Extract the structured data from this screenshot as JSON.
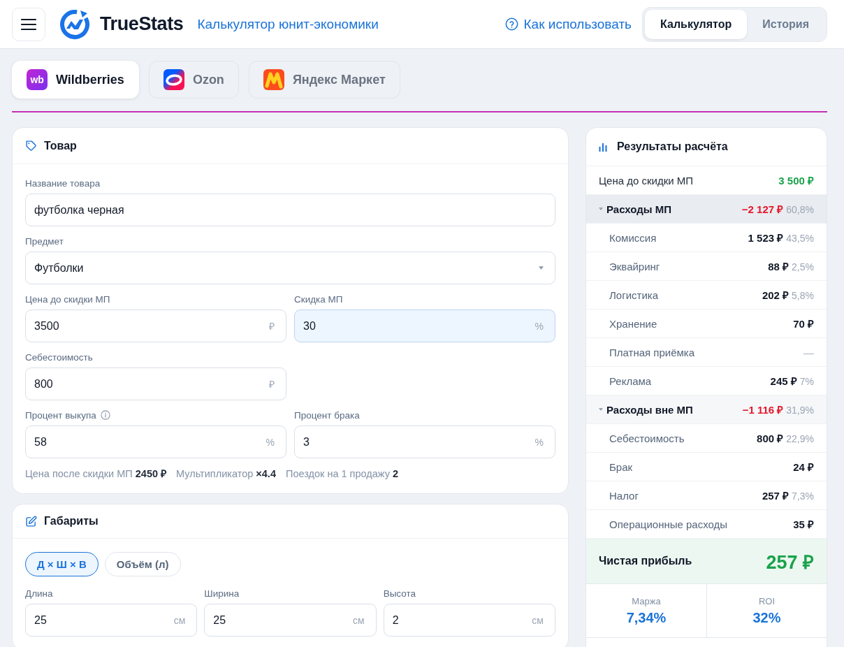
{
  "header": {
    "brand": "TrueStats",
    "subtitle": "Калькулятор юнит-экономики",
    "help_link": "Как использовать",
    "view_tabs": [
      {
        "label": "Калькулятор",
        "selected": true
      },
      {
        "label": "История",
        "selected": false
      }
    ]
  },
  "marketplace_tabs": [
    {
      "kind": "wildberries",
      "logo_text": "wb",
      "label": "Wildberries",
      "selected": true
    },
    {
      "kind": "ozon",
      "label": "Ozon",
      "selected": false
    },
    {
      "kind": "yandex",
      "label": "Яндекс Маркет",
      "selected": false
    }
  ],
  "product_card": {
    "title": "Товар",
    "rows": [
      [
        {
          "kind": "text",
          "label": "Название товара",
          "info": false,
          "value": "футболка черная",
          "focused": false
        }
      ],
      [
        {
          "kind": "select",
          "label": "Предмет",
          "info": false,
          "value": "Футболки",
          "focused": false
        }
      ],
      [
        {
          "kind": "number",
          "label": "Цена до скидки МП",
          "info": false,
          "value": "3500",
          "unit": "₽",
          "focused": false
        },
        {
          "kind": "number",
          "label": "Скидка МП",
          "info": false,
          "value": "30",
          "unit": "%",
          "focused": true
        }
      ],
      [
        {
          "kind": "number",
          "label": "Себестоимость",
          "info": false,
          "value": "800",
          "unit": "₽",
          "focused": false
        }
      ],
      [
        {
          "kind": "number",
          "label": "Процент выкупа",
          "info": true,
          "value": "58",
          "unit": "%",
          "focused": false
        },
        {
          "kind": "number",
          "label": "Процент брака",
          "info": false,
          "value": "3",
          "unit": "%",
          "focused": false
        }
      ]
    ],
    "summary": [
      "Цена после скидки МП **2450 ₽**",
      "Мультипликатор **×4.4**",
      "Поездок на 1 продажу **2**"
    ]
  },
  "dimensions_card": {
    "title": "Габариты",
    "modes": [
      {
        "label": "Д × Ш × В",
        "selected": true
      },
      {
        "label": "Объём (л)",
        "selected": false
      }
    ],
    "fields": [
      {
        "label": "Длина",
        "value": "25",
        "unit": "см"
      },
      {
        "label": "Ширина",
        "value": "25",
        "unit": "см"
      },
      {
        "label": "Высота",
        "value": "2",
        "unit": "см"
      }
    ]
  },
  "results_card": {
    "title": "Результаты расчёта",
    "rows": [
      {
        "kind": "revenue",
        "label": "Цена до скидки МП",
        "value": "3 500 ₽"
      },
      {
        "kind": "group",
        "label": "Расходы МП",
        "value": "−2 127 ₽",
        "share": "60,8%",
        "expanded": true,
        "selected": true,
        "children": [
          {
            "kind": "amount",
            "label": "Комиссия",
            "value": "1 523 ₽",
            "share": "43,5%"
          },
          {
            "kind": "amount",
            "label": "Эквайринг",
            "value": "88 ₽",
            "share": "2,5%"
          },
          {
            "kind": "amount",
            "label": "Логистика",
            "value": "202 ₽",
            "share": "5,8%"
          },
          {
            "kind": "amount",
            "label": "Хранение",
            "value": "70 ₽"
          },
          {
            "kind": "blank",
            "label": "Платная приёмка",
            "value": "—"
          },
          {
            "kind": "amount",
            "label": "Реклама",
            "value": "245 ₽",
            "share": "7%"
          }
        ]
      },
      {
        "kind": "group",
        "label": "Расходы вне МП",
        "value": "−1 116 ₽",
        "share": "31,9%",
        "expanded": true,
        "selected": false,
        "children": [
          {
            "kind": "amount",
            "label": "Себестоимость",
            "value": "800 ₽",
            "share": "22,9%"
          },
          {
            "kind": "amount",
            "label": "Брак",
            "value": "24 ₽"
          },
          {
            "kind": "amount",
            "label": "Налог",
            "value": "257 ₽",
            "share": "7,3%"
          },
          {
            "kind": "amount",
            "label": "Операционные расходы",
            "value": "35 ₽"
          }
        ]
      }
    ],
    "net_profit": {
      "label": "Чистая прибыль",
      "value": "257 ₽"
    },
    "metrics": [
      {
        "label": "Маржа",
        "value": "7,34%"
      },
      {
        "label": "ROI",
        "value": "32%"
      }
    ]
  }
}
